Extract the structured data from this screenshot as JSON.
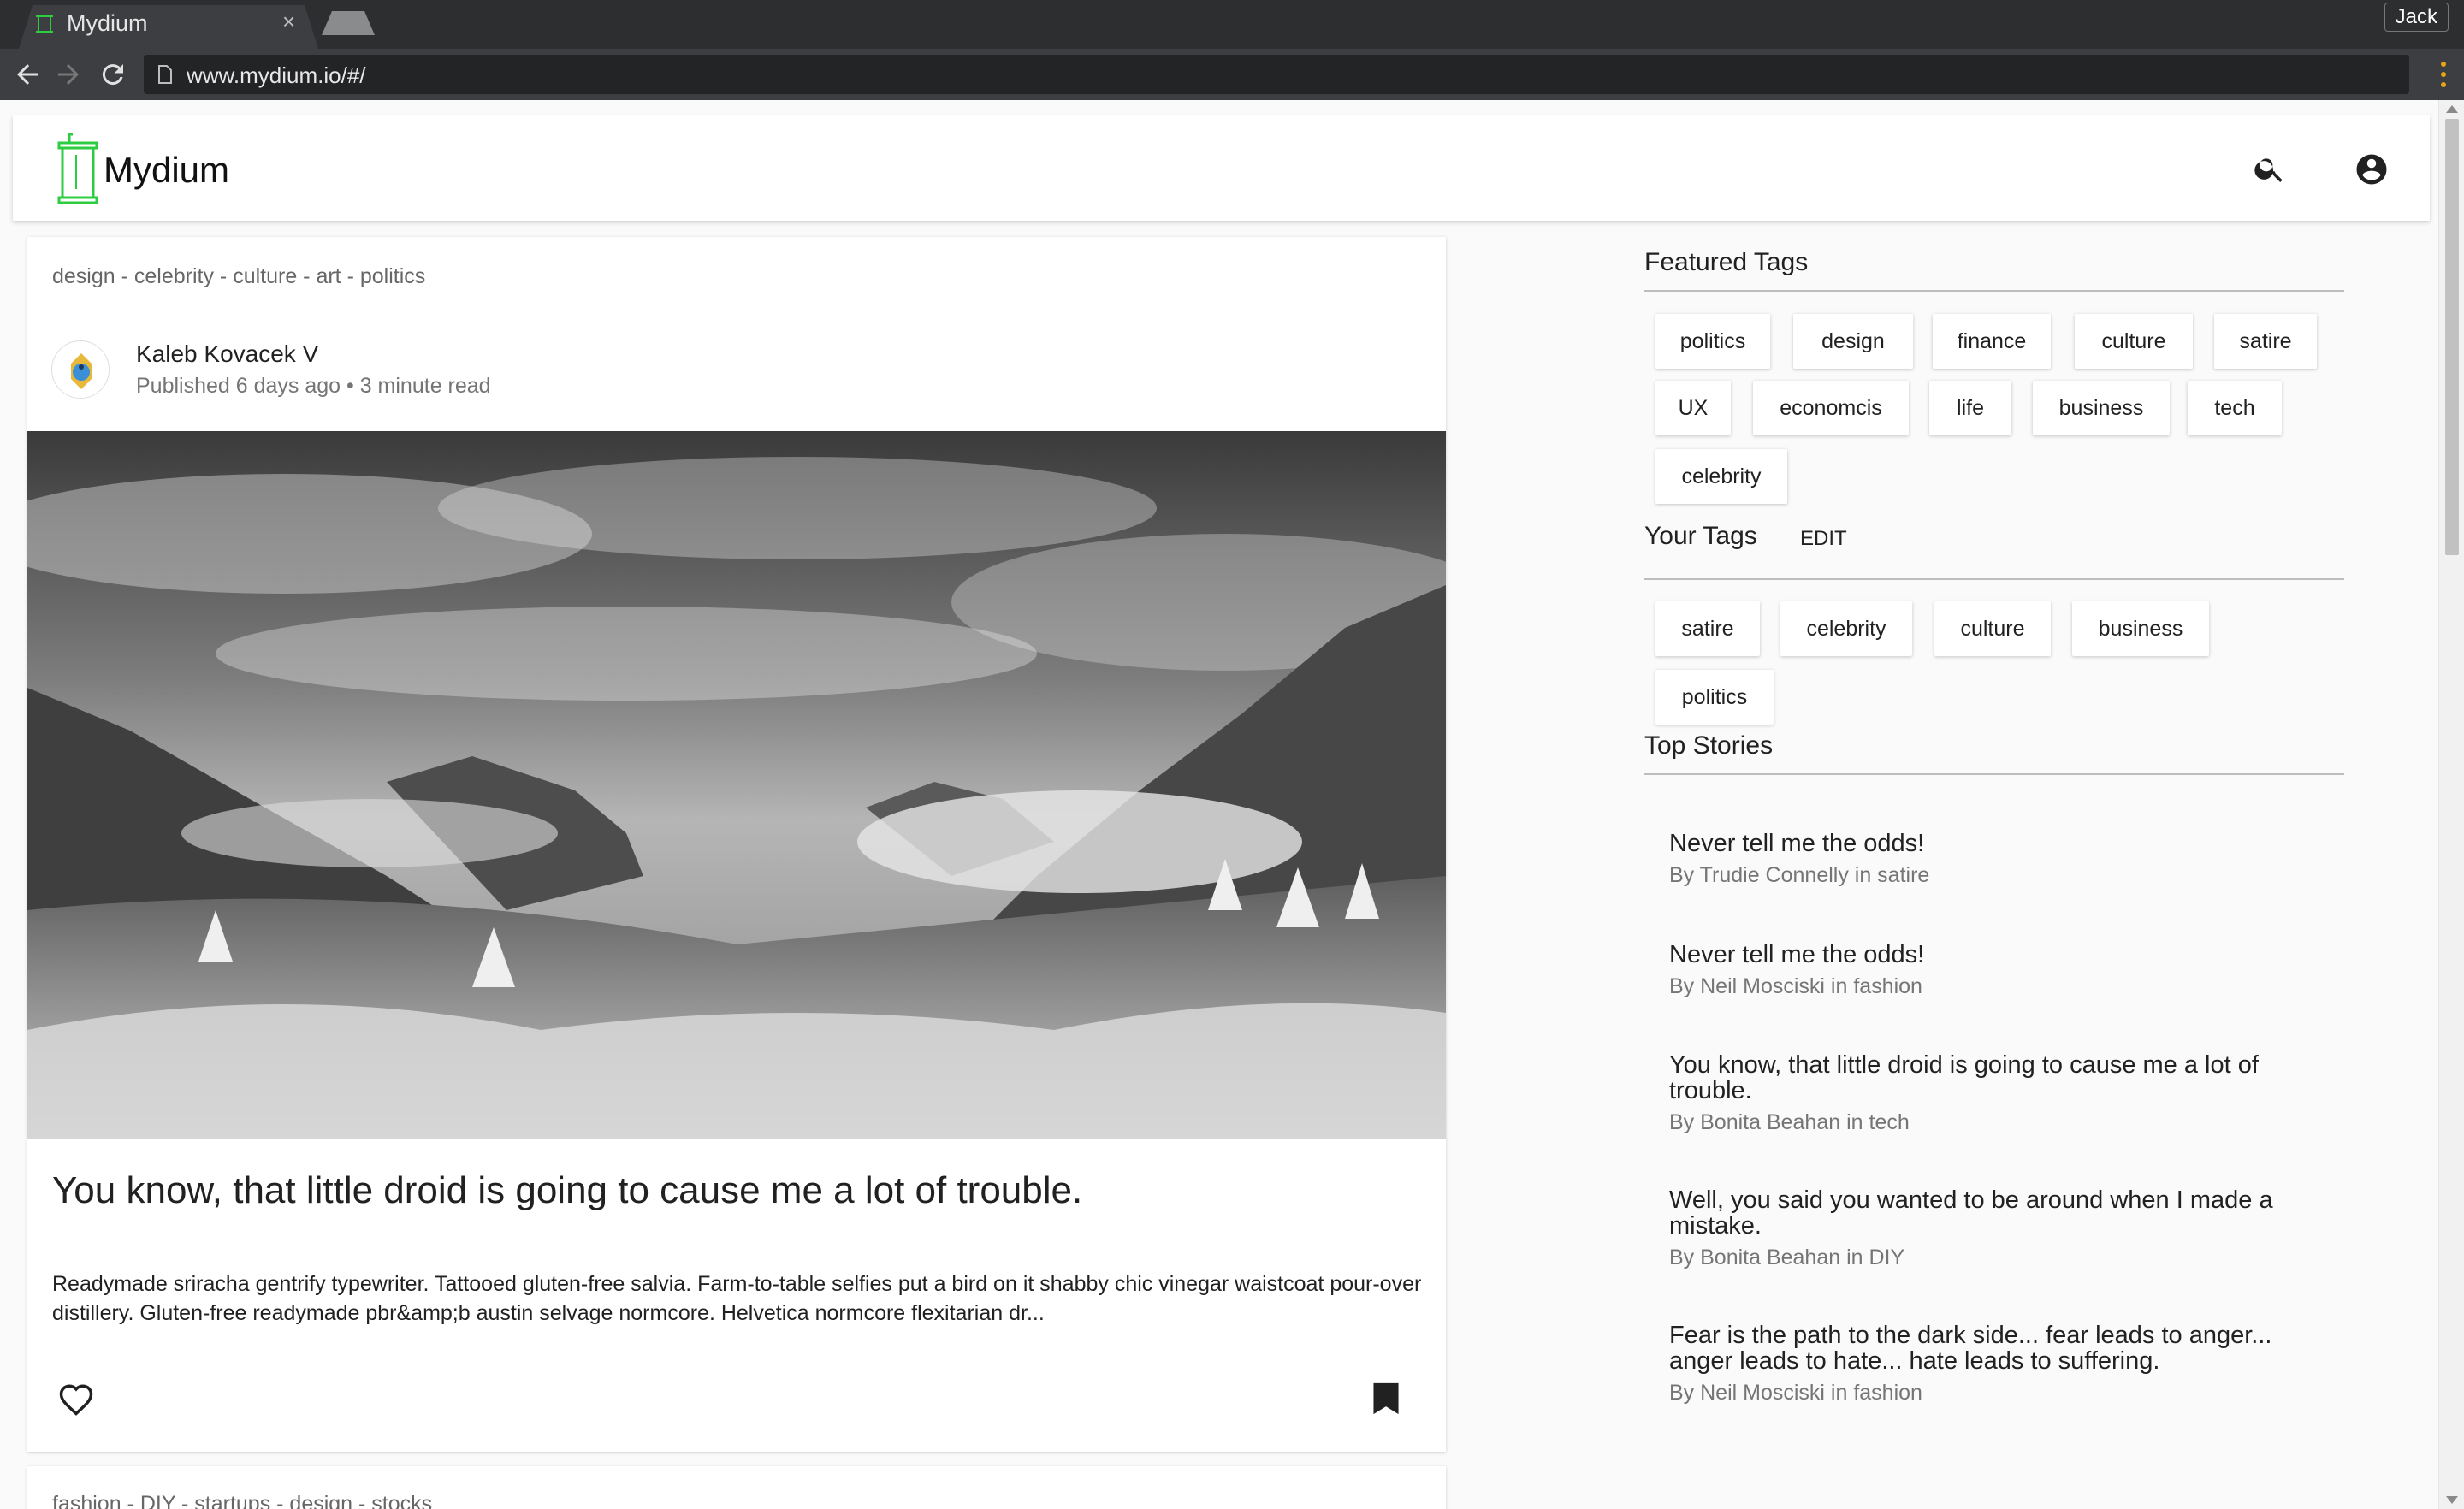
{
  "browser": {
    "tab_title": "Mydium",
    "tab_close": "×",
    "profile_name": "Jack",
    "url": "www.mydium.io/#/"
  },
  "app": {
    "logo_text": "Mydium",
    "brand_color": "#2ecc40"
  },
  "feed": {
    "article": {
      "tags": "design - celebrity - culture - art - politics",
      "author": "Kaleb Kovacek V",
      "meta": "Published 6 days ago • 3 minute read",
      "image": "black and white mountain valley with clouds",
      "title": "You know, that little droid is going to cause me a lot of trouble.",
      "excerpt": "Readymade sriracha gentrify typewriter. Tattooed gluten-free salvia. Farm-to-table selfies put a bird on it shabby chic vinegar waistcoat pour-over distillery. Gluten-free readymade pbr&amp;b austin selvage normcore. Helvetica normcore flexitarian dr..."
    },
    "next_article": {
      "tags": "fashion - DIY - startups - design - stocks"
    }
  },
  "sidebar": {
    "featured_title": "Featured Tags",
    "featured_tags": [
      "politics",
      "design",
      "finance",
      "culture",
      "satire",
      "UX",
      "economcis",
      "life",
      "business",
      "tech",
      "celebrity"
    ],
    "your_title": "Your Tags",
    "edit_label": "EDIT",
    "your_tags": [
      "satire",
      "celebrity",
      "culture",
      "business",
      "politics"
    ],
    "top_title": "Top Stories",
    "top_stories": [
      {
        "title": "Never tell me the odds!",
        "by": "By Trudie Connelly in satire"
      },
      {
        "title": "Never tell me the odds!",
        "by": "By Neil Mosciski in fashion"
      },
      {
        "title": "You know, that little droid is going to cause me a lot of trouble.",
        "by": "By Bonita Beahan in tech"
      },
      {
        "title": "Well, you said you wanted to be around when I made a mistake.",
        "by": "By Bonita Beahan in DIY"
      },
      {
        "title": "Fear is the path to the dark side... fear leads to anger... anger leads to hate... hate leads to suffering.",
        "by": "By Neil Mosciski in fashion"
      }
    ]
  }
}
